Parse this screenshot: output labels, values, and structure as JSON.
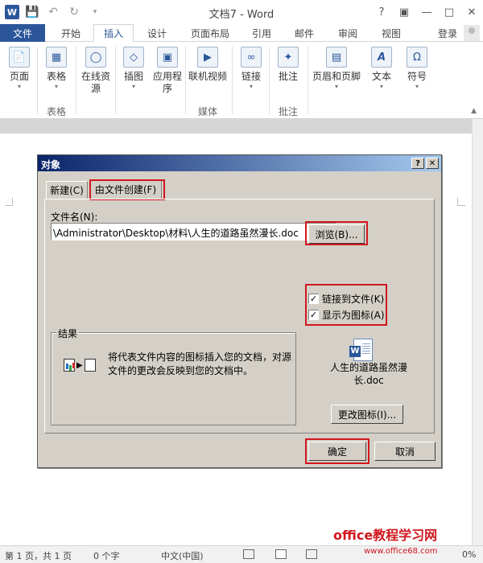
{
  "window": {
    "title": "文档7 - Word",
    "app_icon": "W",
    "qat": {
      "save": "save-icon",
      "undo": "undo-icon",
      "redo": "redo-icon",
      "customize": "customize-icon"
    },
    "controls": {
      "help": "?",
      "restore": "restore-icon",
      "minimize": "minimize-icon",
      "maximize": "maximize-icon",
      "close": "close-icon"
    }
  },
  "tabs": [
    "文件",
    "开始",
    "插入",
    "设计",
    "页面布局",
    "引用",
    "邮件",
    "审阅",
    "视图"
  ],
  "active_tab": "插入",
  "login": "登录",
  "ribbon": {
    "buttons": {
      "page": "页面",
      "table": "表格",
      "online_source_1": "在线资",
      "online_source_2": "源",
      "illustration": "插图",
      "app_1": "应用程",
      "app_2": "序",
      "video": "联机视频",
      "link": "链接",
      "comment": "批注",
      "header_footer": "页眉和页脚",
      "text": "文本",
      "symbol": "符号"
    },
    "groups": {
      "table": "表格",
      "media": "媒体",
      "comments": "批注"
    }
  },
  "dialog": {
    "title": "对象",
    "help_btn": "?",
    "close_btn": "✕",
    "tab_new": "新建(C)",
    "tab_from_file": "由文件创建(F)",
    "filename_label": "文件名(N):",
    "filename_value": "\\Administrator\\Desktop\\材料\\人生的道路虽然漫长.doc",
    "browse_btn": "浏览(B)...",
    "link_to_file": "链接到文件(K)",
    "display_as_icon": "显示为图标(A)",
    "result_title": "结果",
    "result_text": "将代表文件内容的图标插入您的文档，对源文件的更改会反映到您的文档中。",
    "icon_label": "人生的道路虽然漫长.doc",
    "change_icon_btn": "更改图标(I)...",
    "ok_btn": "确定",
    "cancel_btn": "取消"
  },
  "status": {
    "page": "第 1 页，共 1 页",
    "words": "0 个字",
    "language": "中文(中国)",
    "zoom": "0%"
  },
  "watermark": {
    "site": "office教程学习网",
    "url": "www.office68.com"
  },
  "colors": {
    "accent": "#2b579a",
    "highlight": "#d0161e",
    "dialog_bg": "#d4d0c8"
  }
}
